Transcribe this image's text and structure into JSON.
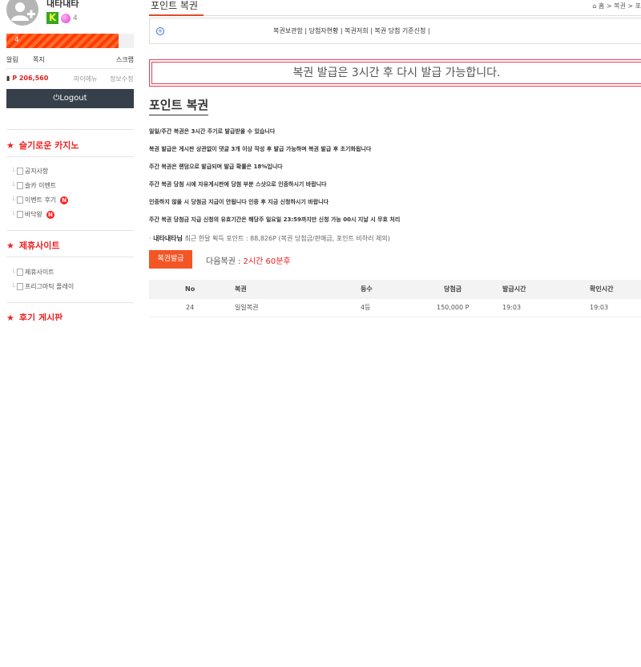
{
  "user": {
    "name": "내타내타",
    "level_badge": "K",
    "level_num": "4",
    "exp_label": "4",
    "exp_fraction": 0.88
  },
  "quick_links": {
    "alert": "알림",
    "memo": "쪽지",
    "scrap": "스크랩"
  },
  "points": {
    "value": "P 206,560",
    "mypage": "마이메뉴",
    "edit_info": "정보수정"
  },
  "logout_label": "Logout",
  "sidebar": {
    "sections": [
      {
        "title": "슬기로운 카지노",
        "items": [
          {
            "label": "공지사항",
            "badge": ""
          },
          {
            "label": "슬카 이벤트",
            "badge": ""
          },
          {
            "label": "이벤트 후기",
            "badge": "N"
          },
          {
            "label": "바닥왕",
            "badge": "N"
          }
        ]
      },
      {
        "title": "제휴사이트",
        "items": [
          {
            "label": "제휴사이트",
            "badge": ""
          },
          {
            "label": "프리그마틱 플레이",
            "badge": ""
          }
        ]
      },
      {
        "title": "후기 게시판",
        "items": []
      }
    ]
  },
  "main": {
    "tab_title": "포인트 복권",
    "breadcrumb": "홈 > 복권 > 포",
    "subnav": "복권보관함 | 당첨자현황 | 복권저희 | 복권 당첨 기준신청 |",
    "alert": "복권 발급은 3시간 후 다시 발급 가능합니다.",
    "heading": "포인트 복권",
    "info": [
      "일일/주간 복권은 3시간 주기로 발급받을 수 있습니다",
      "복권 발급은 게시판 상관없이 댓글 3개 이상 작성 후 발급 가능하며 복권 발급 후 초기화됩니다",
      "주간 복권은 랜덤으로 발급되며 발급 확률은 18%입니다",
      "주간 복권 당첨 시에 자유게시판에 당첨 부분 스샷으로 인증하시기 바랍니다",
      "인증하지 않을 시 당첨금 지급이 안됩니다 인증 후 지금 신청하시기 바랍니다",
      "주간 복권 당첨금 지급 신청의 유효기간은 해당주 일요일 23:59까지만 신청 가능 00시 지날 시 무효 처리"
    ],
    "stat_name": "내타내타님",
    "stat_text": "최근 한달 획득 포인트 : 88,826P (복권 당첨금/판매금, 포인트 비하러 제외)",
    "issue_button": "복권발급",
    "next_label": "다음복권 :",
    "next_time": "2시간 60분후",
    "table": {
      "headers": [
        "No",
        "복권",
        "등수",
        "당첨금",
        "발급시간",
        "확인시간"
      ],
      "rows": [
        [
          "24",
          "일일복권",
          "4등",
          "150,000 P",
          "19:03",
          "19:03"
        ]
      ]
    }
  }
}
